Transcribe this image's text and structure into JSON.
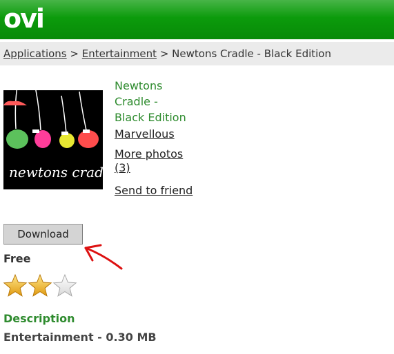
{
  "header": {
    "logo_text": "ovi",
    "brand_color": "#0c9b0c"
  },
  "breadcrumb": {
    "items": [
      "Applications",
      "Entertainment"
    ],
    "separator": ">",
    "current": "Newtons Cradle - Black Edition"
  },
  "app": {
    "thumbnail_text": "newtons cradle",
    "title_lines": [
      "Newtons",
      "Cradle -",
      "Black Edition"
    ],
    "publisher": "Marvellous",
    "more_photos_lines": [
      "More photos",
      "(3)"
    ],
    "send_to_friend": "Send to friend",
    "download_label": "Download",
    "price": "Free",
    "rating": 2,
    "rating_max": 3,
    "description_heading": "Description",
    "category": "Entertainment",
    "size_separator": "-",
    "size": "0.30 MB"
  }
}
